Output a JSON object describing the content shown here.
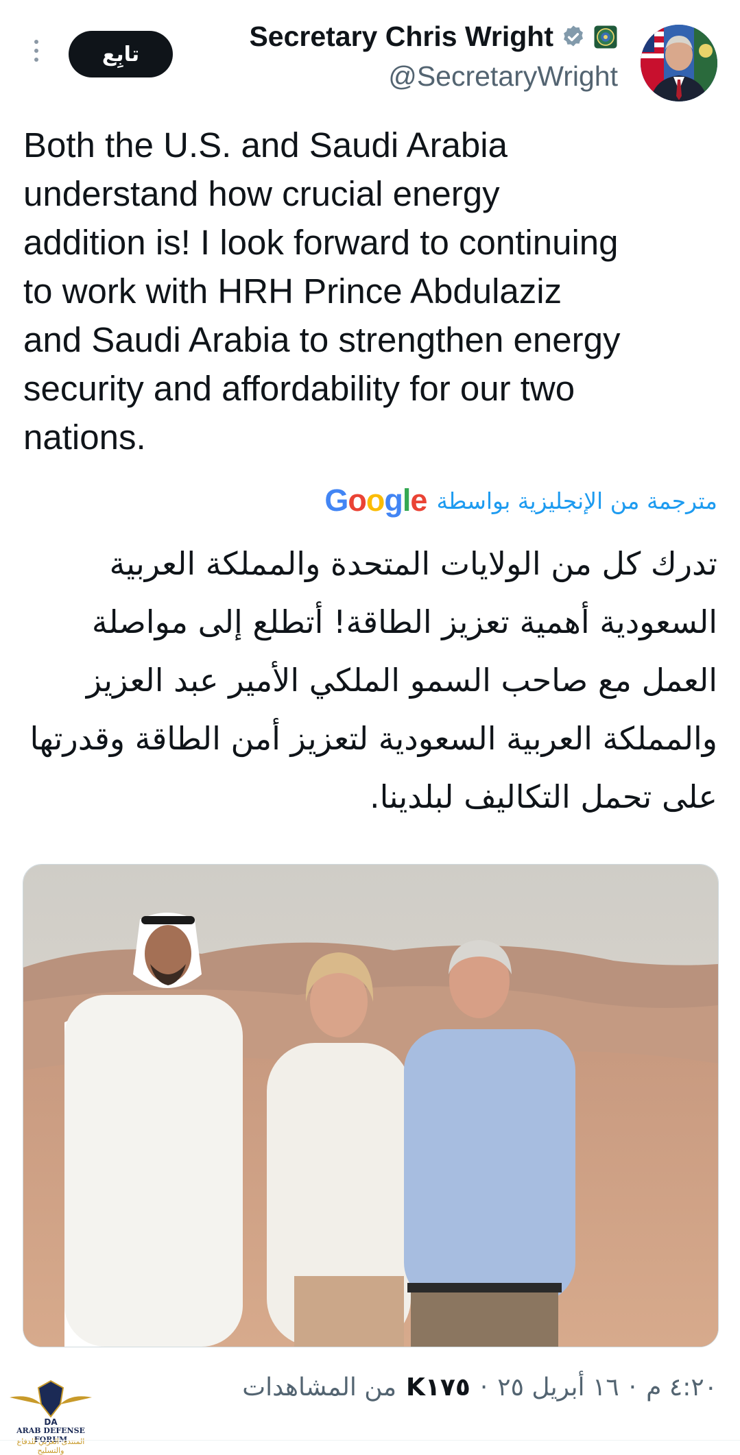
{
  "header": {
    "display_name": "Secretary Chris Wright",
    "handle": "@SecretaryWright",
    "follow_label": "تابِع",
    "verified_badge_color": "#829aab",
    "avatar_icon": "profile-avatar",
    "more_icon": "more-vertical-icon"
  },
  "tweet": {
    "text": "Both the U.S. and Saudi Arabia\nunderstand how crucial energy\naddition is! I look forward to continuing\nto work with HRH Prince Abdulaziz\nand Saudi Arabia to strengthen energy\nsecurity and affordability for our two\nnations.",
    "translation": {
      "label": "مترجمة من الإنجليزية بواسطة",
      "provider": "Google",
      "text": "تدرك كل من الولايات المتحدة والمملكة العربية السعودية أهمية تعزيز الطاقة! أتطلع إلى مواصلة العمل مع صاحب السمو الملكي الأمير عبد العزيز والمملكة العربية السعودية لتعزيز أمن الطاقة وقدرتها على تحمل التكاليف لبلدينا."
    },
    "media": {
      "type": "photo"
    },
    "meta": {
      "time": "٤:٢٠ م",
      "separator": "·",
      "date": "١٦ أبريل ٢٥",
      "views_count": "K١٧٥",
      "views_label": "من المشاهدات"
    }
  },
  "watermark": {
    "title": "ARAB DEFENSE FORUM",
    "subtitle": "المنتدى العربي للدفاع والتسليح"
  },
  "colors": {
    "link_blue": "#1d9bf0",
    "secondary_text": "#536471",
    "primary_text": "#0f1419"
  }
}
